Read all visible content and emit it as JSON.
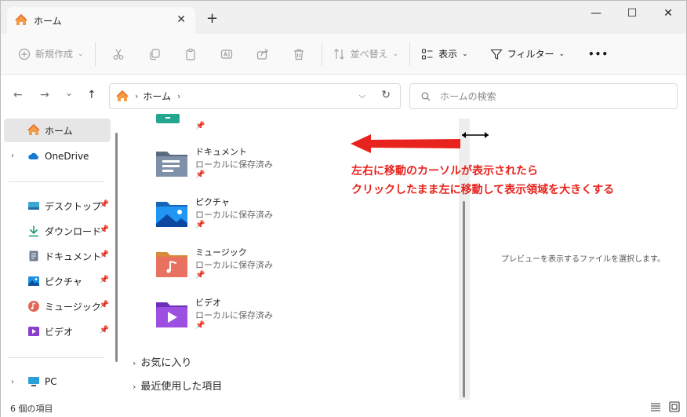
{
  "tab": {
    "title": "ホーム",
    "close": "✕",
    "new_tab": "+"
  },
  "window": {
    "minimize": "—",
    "maximize": "☐",
    "close": "✕"
  },
  "commandbar": {
    "new_label": "新規作成",
    "sort_label": "並べ替え",
    "view_label": "表示",
    "filter_label": "フィルター",
    "more": "•••"
  },
  "address": {
    "crumb": "ホーム",
    "sep1": "›",
    "sep2": "›",
    "chevron": "⌵",
    "refresh": "↻"
  },
  "search": {
    "placeholder": "ホームの検索"
  },
  "nav": {
    "back": "←",
    "forward": "→",
    "recent": "⌄",
    "up": "↑"
  },
  "sidebar": {
    "items": [
      {
        "label": "ホーム"
      },
      {
        "label": "OneDrive"
      },
      {
        "label": "デスクトップ"
      },
      {
        "label": "ダウンロード"
      },
      {
        "label": "ドキュメント"
      },
      {
        "label": "ピクチャ"
      },
      {
        "label": "ミュージック"
      },
      {
        "label": "ビデオ"
      },
      {
        "label": "PC"
      }
    ],
    "pin": "📌"
  },
  "folders": [
    {
      "name": "ドキュメント",
      "sub": "ローカルに保存済み"
    },
    {
      "name": "ピクチャ",
      "sub": "ローカルに保存済み"
    },
    {
      "name": "ミュージック",
      "sub": "ローカルに保存済み"
    },
    {
      "name": "ビデオ",
      "sub": "ローカルに保存済み"
    }
  ],
  "groups": {
    "favorites": "お気に入り",
    "recent": "最近使用した項目",
    "chevron": "›"
  },
  "preview": {
    "message": "プレビューを表示するファイルを選択します。"
  },
  "annotation": {
    "line1": "左右に移動のカーソルが表示されたら",
    "line2": "クリックしたまま左に移動して表示領域を大きくする"
  },
  "status": {
    "count": "6 個の項目"
  },
  "colors": {
    "annotation": "#e8231d",
    "accent": "#0067c0"
  }
}
